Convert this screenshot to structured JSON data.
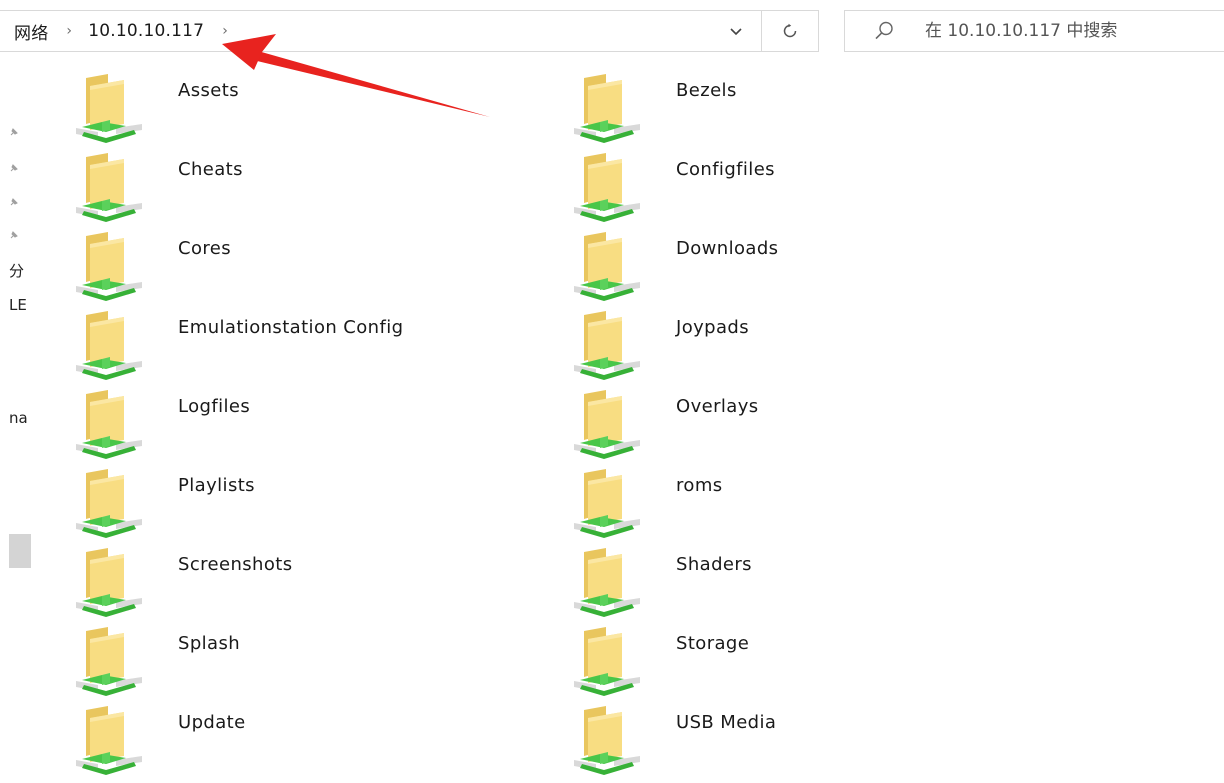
{
  "address_bar": {
    "breadcrumb": [
      "网络",
      "10.10.10.117"
    ],
    "separator": "›",
    "dropdown_glyph": "⌄",
    "refresh_glyph": "↻"
  },
  "search": {
    "placeholder": "在 10.10.10.117 中搜索",
    "icon": "search-icon"
  },
  "nav_pane": {
    "pinned_count": 4,
    "labels": [
      "分",
      "LE",
      "na"
    ]
  },
  "folders": [
    {
      "name": "Assets"
    },
    {
      "name": "Bezels"
    },
    {
      "name": "Cheats"
    },
    {
      "name": "Configfiles"
    },
    {
      "name": "Cores"
    },
    {
      "name": "Downloads"
    },
    {
      "name": "Emulationstation Config"
    },
    {
      "name": "Joypads"
    },
    {
      "name": "Logfiles"
    },
    {
      "name": "Overlays"
    },
    {
      "name": "Playlists"
    },
    {
      "name": "roms"
    },
    {
      "name": "Screenshots"
    },
    {
      "name": "Shaders"
    },
    {
      "name": "Splash"
    },
    {
      "name": "Storage"
    },
    {
      "name": "Update"
    },
    {
      "name": "USB Media"
    }
  ],
  "colors": {
    "folder_body": "#f6d97a",
    "folder_back": "#e8c45a",
    "share_green": "#3fbf3f",
    "annotation_red": "#e8231f"
  }
}
